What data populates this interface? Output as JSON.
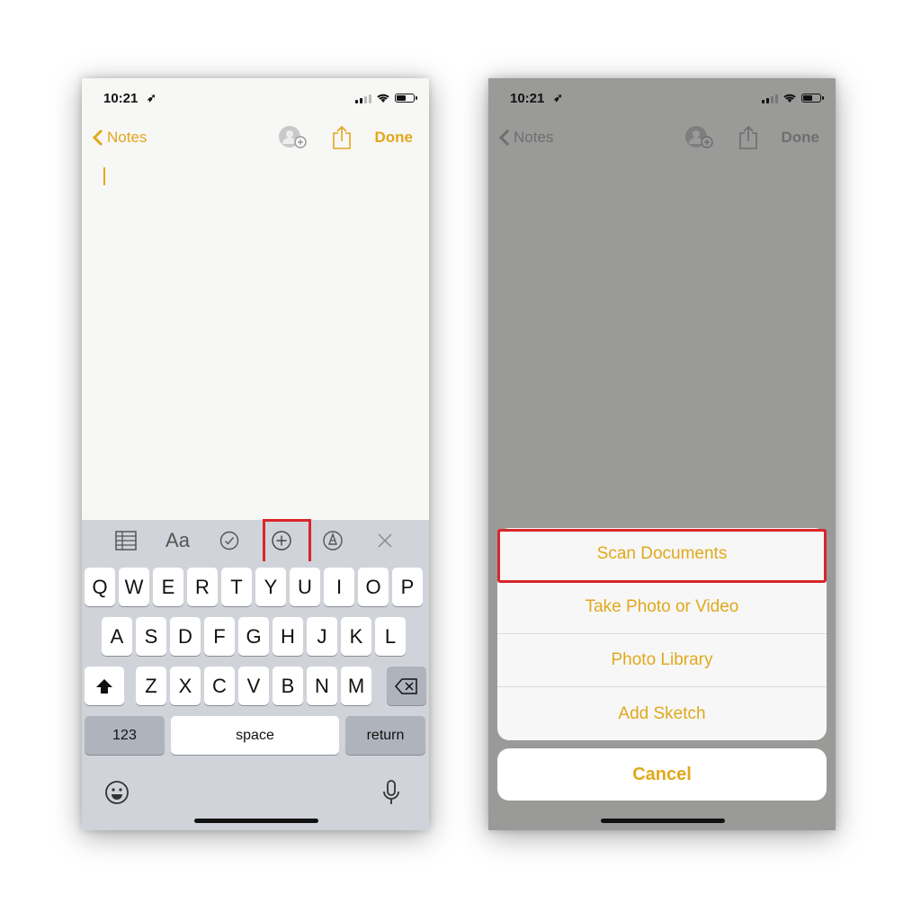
{
  "left": {
    "status": {
      "time": "10:21"
    },
    "nav": {
      "back_label": "Notes",
      "done_label": "Done"
    },
    "keyboard": {
      "row1": [
        "Q",
        "W",
        "E",
        "R",
        "T",
        "Y",
        "U",
        "I",
        "O",
        "P"
      ],
      "row2": [
        "A",
        "S",
        "D",
        "F",
        "G",
        "H",
        "J",
        "K",
        "L"
      ],
      "row3": [
        "Z",
        "X",
        "C",
        "V",
        "B",
        "N",
        "M"
      ],
      "numbers_label": "123",
      "space_label": "space",
      "return_label": "return"
    },
    "toolbar": {
      "format_label": "Aa"
    }
  },
  "right": {
    "status": {
      "time": "10:21"
    },
    "nav": {
      "back_label": "Notes",
      "done_label": "Done"
    },
    "sheet": {
      "options": [
        "Scan Documents",
        "Take Photo or Video",
        "Photo Library",
        "Add Sketch"
      ],
      "cancel_label": "Cancel"
    }
  },
  "colors": {
    "accent": "#e2a71c",
    "highlight": "#d8262b"
  }
}
